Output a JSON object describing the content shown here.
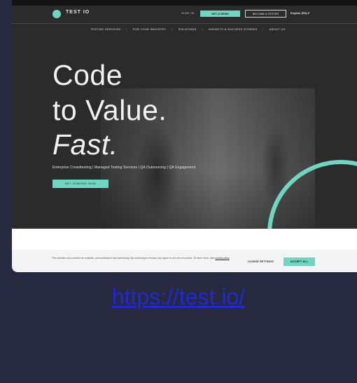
{
  "site": {
    "logo_text": "TEST IO",
    "nav": {
      "signin": "SIGN IN",
      "cta": "GET A DEMO",
      "outline": "BECOME A TESTER",
      "lang": "English (EN) ▾"
    },
    "menu": [
      "TESTING SERVICES",
      "FOR YOUR INDUSTRY",
      "SOLUTIONS",
      "INSIGHTS & SUCCESS STORIES",
      "ABOUT US"
    ]
  },
  "hero": {
    "line1": "Code",
    "line2": "to Value.",
    "line3": "Fast.",
    "tagline": "Enterprise Crowdtesting | Managed Testing Services | QA Outsourcing | QA Engagement",
    "cta": "GET STARTED NOW"
  },
  "cookie": {
    "text": "This website uses cookies for analytics, personalization and advertising. By continuing to browse, you agree to our use of cookies. To learn more, click",
    "link": "cookie policy",
    "settings": "COOKIE SETTINGS",
    "accept": "ACCEPT ALL"
  },
  "caption": {
    "url": "https://test.io/"
  },
  "colors": {
    "accent": "#6fd6c0",
    "page_bg": "#262a40",
    "link": "#1f29d6"
  }
}
